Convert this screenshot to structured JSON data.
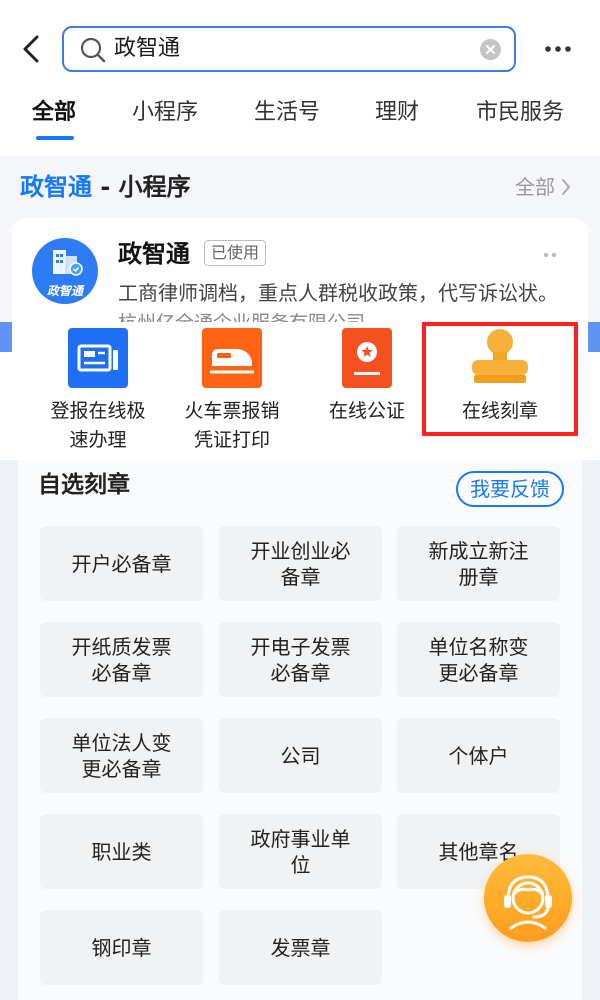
{
  "header": {
    "back_icon": "chevron-left-icon",
    "search": {
      "value": "政智通",
      "icon": "search-icon",
      "clear_icon": "clear-icon"
    },
    "more_icon": "more-icon"
  },
  "tabs": [
    {
      "label": "全部",
      "active": true
    },
    {
      "label": "小程序",
      "active": false
    },
    {
      "label": "生活号",
      "active": false
    },
    {
      "label": "理财",
      "active": false
    },
    {
      "label": "市民服务",
      "active": false
    }
  ],
  "section": {
    "title_highlight": "政智通",
    "title_rest": " - 小程序",
    "all_label": "全部",
    "all_icon": "chevron-right-icon"
  },
  "app_card": {
    "icon": "zhengzhitong-logo",
    "logo_text": "政智通",
    "name": "政智通",
    "badge": "已使用",
    "more_icon": "more-icon",
    "description": "工商律师调档，重点人群税收政策，代写诉讼状。",
    "company": "杭州亿全通企业服务有限公司"
  },
  "services": [
    {
      "label": "登报在线极速办理",
      "icon": "newspaper-icon",
      "color": "#1e6ff5"
    },
    {
      "label": "火车票报销凭证打印",
      "icon": "train-icon",
      "color": "#ff6414"
    },
    {
      "label": "在线公证",
      "icon": "certificate-icon",
      "color": "#f4511e"
    },
    {
      "label": "在线刻章",
      "icon": "stamp-icon",
      "color": "#f7b13a",
      "highlighted": true
    }
  ],
  "highlight_color": "#ff2020",
  "stamp_panel": {
    "title": "自选刻章",
    "feedback_label": "我要反馈",
    "items": [
      "开户必备章",
      "开业创业必备章",
      "新成立新注册章",
      "开纸质发票必备章",
      "开电子发票必备章",
      "单位名称变更必备章",
      "单位法人变更必备章",
      "公司",
      "个体户",
      "职业类",
      "政府事业单位",
      "其他章名",
      "钢印章",
      "发票章"
    ]
  },
  "floating_button": {
    "icon": "customer-service-icon",
    "color": "#ffaa2a"
  },
  "colors": {
    "accent": "#1677ff",
    "tile_bg": "#f1f2f4"
  }
}
